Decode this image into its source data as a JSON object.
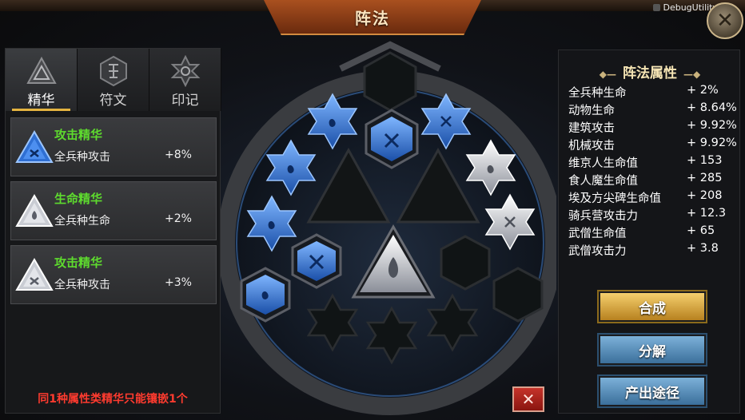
{
  "window": {
    "title": "阵法",
    "debug_label": "DebugUtility",
    "close_icon": "close-icon"
  },
  "tabs": [
    {
      "label": "精华",
      "icon": "triangle-rune-icon",
      "active": true
    },
    {
      "label": "符文",
      "icon": "hexagon-rune-icon",
      "active": false
    },
    {
      "label": "印记",
      "icon": "star-rune-icon",
      "active": false
    }
  ],
  "essences": [
    {
      "name": "攻击精华",
      "stat": "全兵种攻击",
      "value": "+8%",
      "gem": "blue-triangle-gem-icon"
    },
    {
      "name": "生命精华",
      "stat": "全兵种生命",
      "value": "+2%",
      "gem": "silver-triangle-gem-icon"
    },
    {
      "name": "攻击精华",
      "stat": "全兵种攻击",
      "value": "+3%",
      "gem": "silver-triangle-gem-icon"
    }
  ],
  "warning": "同1种属性类精华只能镶嵌1个",
  "attributes": {
    "header": "阵法属性",
    "rows": [
      {
        "name": "全兵种生命",
        "value": "+ 2%"
      },
      {
        "name": "动物生命",
        "value": "+ 8.64%"
      },
      {
        "name": "建筑攻击",
        "value": "+ 9.92%"
      },
      {
        "name": "机械攻击",
        "value": "+ 9.92%"
      },
      {
        "name": "维京人生命值",
        "value": "+ 153"
      },
      {
        "name": "食人魔生命值",
        "value": "+ 285"
      },
      {
        "name": "埃及方尖碑生命值",
        "value": "+ 208"
      },
      {
        "name": "骑兵营攻击力",
        "value": "+ 12.3"
      },
      {
        "name": "武僧生命值",
        "value": "+ 65"
      },
      {
        "name": "武僧攻击力",
        "value": "+ 3.8"
      }
    ]
  },
  "buttons": {
    "combine": "合成",
    "decompose": "分解",
    "source": "产出途径",
    "delete": "✕"
  },
  "colors": {
    "essence_name": "#5edb2e",
    "warning": "#ff3b2f",
    "gem_blue": "#2f6fd3",
    "gem_silver": "#c9ccd3",
    "button_gold": "#d9a53a",
    "button_blue": "#5a90bd"
  }
}
